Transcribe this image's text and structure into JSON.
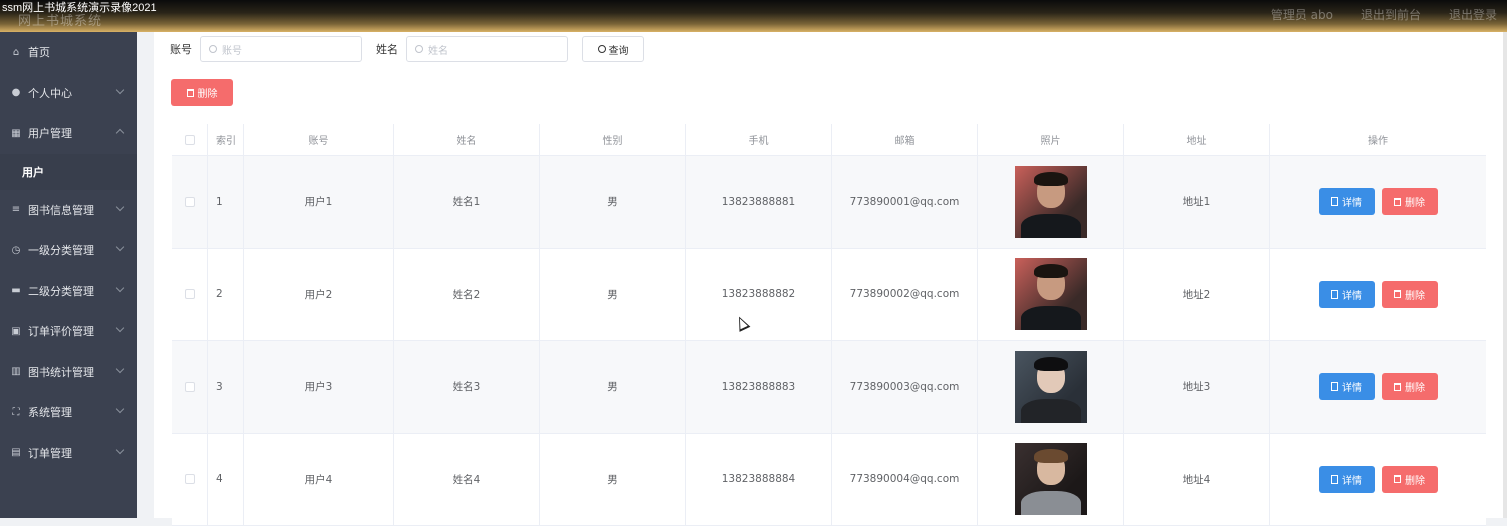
{
  "header": {
    "video_title": "ssm网上书城系统演示录像2021",
    "site_title": "网上书城系统",
    "right_items": [
      "管理员 abo",
      "退出到前台",
      "退出登录"
    ]
  },
  "sidebar": {
    "items": [
      {
        "label": "首页",
        "icon": "home-icon"
      },
      {
        "label": "个人中心",
        "icon": "user-icon"
      },
      {
        "label": "用户管理",
        "icon": "grid-icon",
        "expanded": true,
        "sub": [
          "用户"
        ]
      },
      {
        "label": "图书信息管理",
        "icon": "list-icon"
      },
      {
        "label": "一级分类管理",
        "icon": "clock-icon"
      },
      {
        "label": "二级分类管理",
        "icon": "monitor-icon"
      },
      {
        "label": "订单评价管理",
        "icon": "clipboard-icon"
      },
      {
        "label": "图书统计管理",
        "icon": "chart-icon"
      },
      {
        "label": "系统管理",
        "icon": "expand-icon"
      },
      {
        "label": "订单管理",
        "icon": "order-icon"
      }
    ]
  },
  "search": {
    "account_label": "账号",
    "account_placeholder": "账号",
    "name_label": "姓名",
    "name_placeholder": "姓名",
    "query_button": "查询"
  },
  "toolbar": {
    "delete_label": "删除"
  },
  "table": {
    "headers": [
      "索引",
      "账号",
      "姓名",
      "性别",
      "手机",
      "邮箱",
      "照片",
      "地址",
      "操作"
    ],
    "rows": [
      {
        "index": "1",
        "account": "用户1",
        "name": "姓名1",
        "gender": "男",
        "phone": "13823888881",
        "email": "773890001@qq.com",
        "address": "地址1"
      },
      {
        "index": "2",
        "account": "用户2",
        "name": "姓名2",
        "gender": "男",
        "phone": "13823888882",
        "email": "773890002@qq.com",
        "address": "地址2"
      },
      {
        "index": "3",
        "account": "用户3",
        "name": "姓名3",
        "gender": "男",
        "phone": "13823888883",
        "email": "773890003@qq.com",
        "address": "地址3"
      },
      {
        "index": "4",
        "account": "用户4",
        "name": "姓名4",
        "gender": "男",
        "phone": "13823888884",
        "email": "773890004@qq.com",
        "address": "地址4"
      }
    ],
    "detail_label": "详情",
    "delete_label": "删除"
  },
  "colors": {
    "primary": "#3a8ee6",
    "danger": "#f56c6c",
    "sidebar_bg": "#3b4150"
  }
}
